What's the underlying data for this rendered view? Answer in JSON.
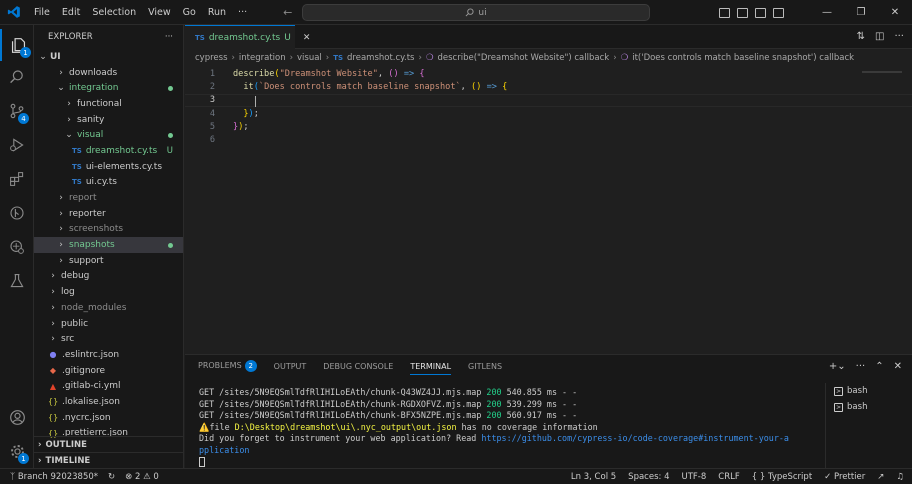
{
  "titlebar": {
    "menu": [
      "File",
      "Edit",
      "Selection",
      "View",
      "Go",
      "Run",
      "···"
    ],
    "search_text": "ui"
  },
  "activity": {
    "explorer_badge": "1",
    "scm_badge": "4",
    "accounts_badge": "1"
  },
  "explorer": {
    "title": "EXPLORER",
    "root": "UI",
    "items": [
      {
        "label": "downloads",
        "indent": 1,
        "kind": "folder",
        "open": false,
        "color": "#cccccc"
      },
      {
        "label": "integration",
        "indent": 1,
        "kind": "folder",
        "open": true,
        "color": "#73c991",
        "dot": true
      },
      {
        "label": "functional",
        "indent": 2,
        "kind": "folder",
        "open": false,
        "color": "#cccccc"
      },
      {
        "label": "sanity",
        "indent": 2,
        "kind": "folder",
        "open": false,
        "color": "#cccccc"
      },
      {
        "label": "visual",
        "indent": 2,
        "kind": "folder",
        "open": true,
        "color": "#73c991",
        "dot": true
      },
      {
        "label": "dreamshot.cy.ts",
        "indent": 3,
        "kind": "ts",
        "color": "#73c991",
        "status": "U"
      },
      {
        "label": "ui-elements.cy.ts",
        "indent": 3,
        "kind": "ts",
        "color": "#cccccc"
      },
      {
        "label": "ui.cy.ts",
        "indent": 3,
        "kind": "ts",
        "color": "#cccccc"
      },
      {
        "label": "report",
        "indent": 1,
        "kind": "folder",
        "open": false,
        "color": "#8c8c8c"
      },
      {
        "label": "reporter",
        "indent": 1,
        "kind": "folder",
        "open": false,
        "color": "#cccccc"
      },
      {
        "label": "screenshots",
        "indent": 1,
        "kind": "folder",
        "open": false,
        "color": "#8c8c8c"
      },
      {
        "label": "snapshots",
        "indent": 1,
        "kind": "folder",
        "open": false,
        "color": "#73c991",
        "dot": true,
        "selected": true
      },
      {
        "label": "support",
        "indent": 1,
        "kind": "folder",
        "open": false,
        "color": "#cccccc"
      },
      {
        "label": "debug",
        "indent": 0,
        "kind": "folder",
        "open": false,
        "color": "#cccccc"
      },
      {
        "label": "log",
        "indent": 0,
        "kind": "folder",
        "open": false,
        "color": "#cccccc"
      },
      {
        "label": "node_modules",
        "indent": 0,
        "kind": "folder",
        "open": false,
        "color": "#8c8c8c"
      },
      {
        "label": "public",
        "indent": 0,
        "kind": "folder",
        "open": false,
        "color": "#cccccc"
      },
      {
        "label": "src",
        "indent": 0,
        "kind": "folder",
        "open": false,
        "color": "#cccccc"
      },
      {
        "label": ".eslintrc.json",
        "indent": 0,
        "kind": "eslint",
        "color": "#cccccc"
      },
      {
        "label": ".gitignore",
        "indent": 0,
        "kind": "git",
        "color": "#cccccc"
      },
      {
        "label": ".gitlab-ci.yml",
        "indent": 0,
        "kind": "gitlab",
        "color": "#cccccc"
      },
      {
        "label": ".lokalise.json",
        "indent": 0,
        "kind": "json",
        "color": "#cccccc"
      },
      {
        "label": ".nycrc.json",
        "indent": 0,
        "kind": "json",
        "color": "#cccccc"
      },
      {
        "label": ".prettierrc.json",
        "indent": 0,
        "kind": "json",
        "color": "#cccccc"
      }
    ],
    "outline": "OUTLINE",
    "timeline": "TIMELINE"
  },
  "tabs": [
    {
      "label": "dreamshot.cy.ts",
      "status": "U",
      "icon": "TS"
    }
  ],
  "breadcrumb": [
    "cypress",
    "integration",
    "visual",
    "dreamshot.cy.ts",
    "describe(\"Dreamshot Website\") callback",
    "it('Does controls match baseline snapshot') callback"
  ],
  "code": {
    "line_numbers": [
      "1",
      "2",
      "3",
      "4",
      "5",
      "6"
    ],
    "lines": [
      [
        {
          "t": "describe",
          "c": "tk-fn"
        },
        {
          "t": "(",
          "c": "tk-p1"
        },
        {
          "t": "\"Dreamshot Website\"",
          "c": "tk-str"
        },
        {
          "t": ", ",
          "c": "tk-op"
        },
        {
          "t": "(",
          "c": "tk-p2"
        },
        {
          "t": ")",
          "c": "tk-p2"
        },
        {
          "t": " ",
          "c": "tk-op"
        },
        {
          "t": "=>",
          "c": "tk-kw"
        },
        {
          "t": " ",
          "c": "tk-op"
        },
        {
          "t": "{",
          "c": "tk-p2"
        }
      ],
      [
        {
          "t": "  it",
          "c": "tk-fn"
        },
        {
          "t": "(",
          "c": "tk-p3"
        },
        {
          "t": "`Does controls match baseline snapshot`",
          "c": "tk-str"
        },
        {
          "t": ", ",
          "c": "tk-op"
        },
        {
          "t": "(",
          "c": "tk-p1"
        },
        {
          "t": ")",
          "c": "tk-p1"
        },
        {
          "t": " ",
          "c": "tk-op"
        },
        {
          "t": "=>",
          "c": "tk-kw"
        },
        {
          "t": " ",
          "c": "tk-op"
        },
        {
          "t": "{",
          "c": "tk-p1"
        }
      ],
      [
        {
          "t": "",
          "c": "tk-op"
        }
      ],
      [
        {
          "t": "  ",
          "c": "tk-op"
        },
        {
          "t": "}",
          "c": "tk-p1"
        },
        {
          "t": ")",
          "c": "tk-p3"
        },
        {
          "t": ";",
          "c": "tk-op"
        }
      ],
      [
        {
          "t": "}",
          "c": "tk-p2"
        },
        {
          "t": ")",
          "c": "tk-p1"
        },
        {
          "t": ";",
          "c": "tk-op"
        }
      ],
      [
        {
          "t": "",
          "c": "tk-op"
        }
      ]
    ]
  },
  "panel": {
    "tabs": [
      "PROBLEMS",
      "OUTPUT",
      "DEBUG CONSOLE",
      "TERMINAL",
      "GITLENS"
    ],
    "problems_count": "2",
    "active_tab": "TERMINAL",
    "terminal_lines": [
      [
        {
          "t": "GET /sites/5N9EQSmlTdfRlIHILoEAth/chunk-Q43WZ4JJ.mjs.map ",
          "c": ""
        },
        {
          "t": "200",
          "c": "g"
        },
        {
          "t": " 540.855 ms - -",
          "c": ""
        }
      ],
      [
        {
          "t": "GET /sites/5N9EQSmlTdfRlIHILoEAth/chunk-RGDXOFVZ.mjs.map ",
          "c": ""
        },
        {
          "t": "200",
          "c": "g"
        },
        {
          "t": " 539.299 ms - -",
          "c": ""
        }
      ],
      [
        {
          "t": "GET /sites/5N9EQSmlTdfRlIHILoEAth/chunk-BFX5NZPE.mjs.map ",
          "c": ""
        },
        {
          "t": "200",
          "c": "g"
        },
        {
          "t": " 560.917 ms - -",
          "c": ""
        }
      ],
      [
        {
          "t": "⚠️",
          "c": "warn"
        },
        {
          "t": "file ",
          "c": ""
        },
        {
          "t": "D:\\Desktop\\dreamshot\\ui\\.nyc_output\\out.json",
          "c": "y"
        },
        {
          "t": " has no coverage information",
          "c": ""
        }
      ],
      [
        {
          "t": "Did you forget to instrument your web application? Read ",
          "c": ""
        },
        {
          "t": "https://github.com/cypress-io/code-coverage#instrument-your-a",
          "c": "link"
        }
      ],
      [
        {
          "t": "pplication",
          "c": "link"
        }
      ]
    ],
    "shells": [
      "bash",
      "bash"
    ]
  },
  "status": {
    "branch": "Branch 92023850*",
    "errors": "2",
    "warnings": "0",
    "position": "Ln 3, Col 5",
    "spaces": "Spaces: 4",
    "encoding": "UTF-8",
    "eol": "CRLF",
    "language": "TypeScript",
    "formatter": "Prettier"
  },
  "colors": {
    "accent": "#0078d4",
    "untracked": "#73c991",
    "background": "#1f1f1f"
  }
}
